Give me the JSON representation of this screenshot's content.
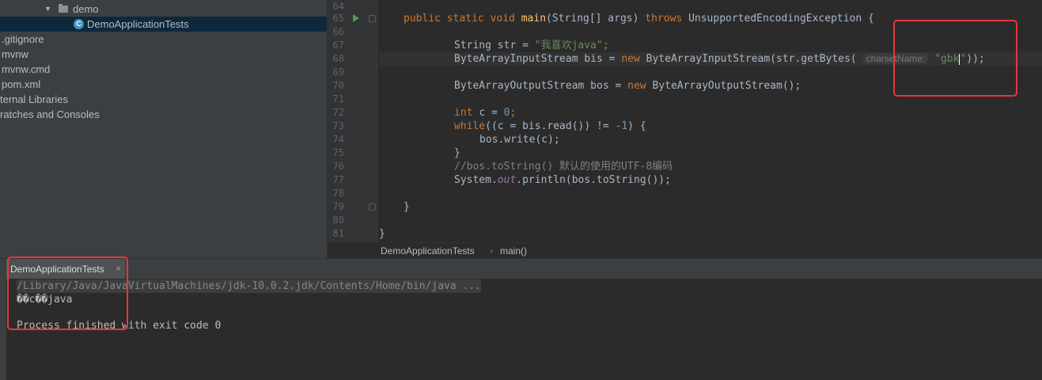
{
  "tree": {
    "items": [
      {
        "label": "demo",
        "kind": "folder"
      },
      {
        "label": "DemoApplicationTests",
        "kind": "class"
      },
      {
        "label": ".gitignore",
        "kind": "file"
      },
      {
        "label": "mvnw",
        "kind": "file"
      },
      {
        "label": "mvnw.cmd",
        "kind": "file"
      },
      {
        "label": "pom.xml",
        "kind": "file"
      },
      {
        "label": "ternal Libraries",
        "kind": "library"
      },
      {
        "label": "ratches and Consoles",
        "kind": "scratch"
      }
    ]
  },
  "editor": {
    "line_numbers": [
      "64",
      "65",
      "66",
      "67",
      "68",
      "69",
      "70",
      "71",
      "72",
      "73",
      "74",
      "75",
      "76",
      "77",
      "78",
      "79",
      "80",
      "81"
    ],
    "code": {
      "l65_kw": "public static void ",
      "l65_fn": "main",
      "l65_a": "(String[] args) ",
      "l65_kw2": "throws ",
      "l65_b": "UnsupportedEncodingException {",
      "l67_a": "String str = ",
      "l67_str": "\"我喜欢java\"",
      "l67_end": ";",
      "l68_a": "ByteArrayInputStream bis = ",
      "l68_kw": "new ",
      "l68_b": "ByteArrayInputStream(str.getBytes(",
      "l68_hint": "charsetName:",
      "l68_str_a": "\"gbk",
      "l68_str_b": "\"",
      "l68_end": "));",
      "l70_a": "ByteArrayOutputStream bos = ",
      "l70_kw": "new ",
      "l70_b": "ByteArrayOutputStream();",
      "l72_kw": "int ",
      "l72_a": "c = ",
      "l72_num": "0",
      "l72_end": ";",
      "l73_kw": "while",
      "l73_a": "((c = bis.read()) != ",
      "l73_num": "-1",
      "l73_end": ") {",
      "l74": "bos.write(c);",
      "l75": "}",
      "l76": "//bos.toString() 默认的使用的UTF-8编码",
      "l77_a": "System.",
      "l77_field": "out",
      "l77_b": ".println(bos.toString());",
      "l79": "}",
      "l81": "}"
    }
  },
  "breadcrumb": {
    "class_name": "DemoApplicationTests",
    "separator": "›",
    "method": "main()"
  },
  "run": {
    "tab_label": "DemoApplicationTests",
    "close": "×",
    "command": "/Library/Java/JavaVirtualMachines/jdk-10.0.2.jdk/Contents/Home/bin/java ...",
    "output": "��c��java",
    "exit": "Process finished with exit code 0"
  },
  "colors": {
    "highlight": "#e8363b",
    "keyword": "#cc7832",
    "string": "#6a8759",
    "function": "#ffc66d",
    "number": "#6897bb"
  }
}
